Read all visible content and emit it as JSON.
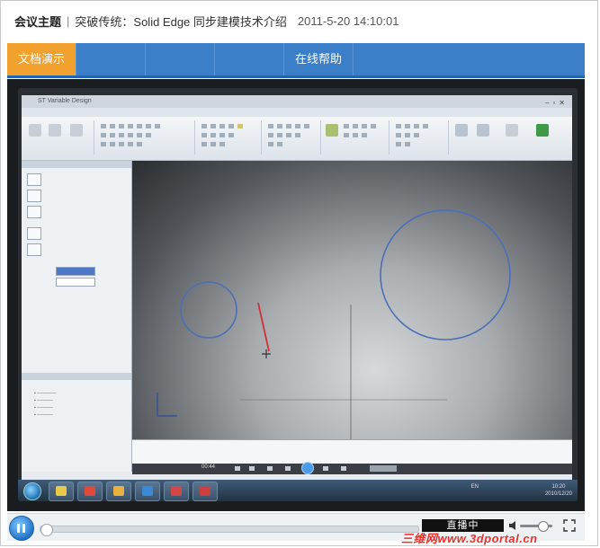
{
  "header": {
    "label": "会议主题",
    "separator": "|",
    "topic": "突破传统：Solid Edge 同步建模技术介绍",
    "timestamp": "2011-5-20 14:10:01"
  },
  "tabs": [
    {
      "label": "文档演示",
      "state": "active"
    },
    {
      "label": "",
      "state": "disabled"
    },
    {
      "label": "",
      "state": "disabled"
    },
    {
      "label": "",
      "state": "disabled"
    },
    {
      "label": "在线帮助",
      "state": "enabled"
    }
  ],
  "video": {
    "app_title": "ST Variable Design",
    "player_time": "00:44",
    "taskbar_clock": "10:20",
    "taskbar_date": "2010/12/20",
    "taskbar_lang": "EN"
  },
  "controls": {
    "live_label": "直播中",
    "progress_fraction": 0.0,
    "volume_fraction": 0.75
  },
  "watermark": "三维网www.3dportal.cn",
  "colors": {
    "tab_bar": "#3a7fc8",
    "tab_active": "#f2a02e",
    "watermark": "#e8322c"
  },
  "icons": [
    "play-pause-icon",
    "volume-icon",
    "fullscreen-icon",
    "windows-start-icon"
  ]
}
